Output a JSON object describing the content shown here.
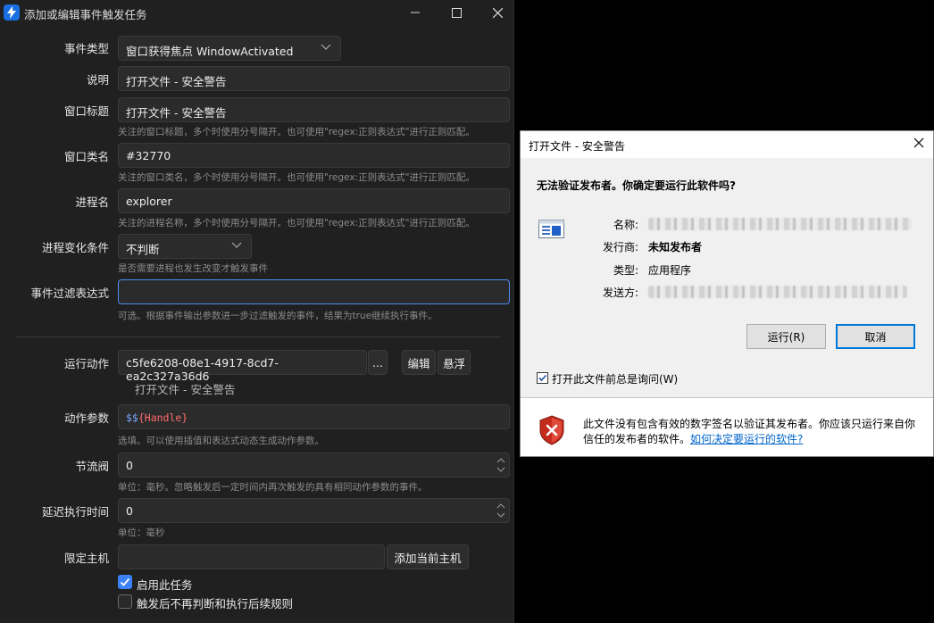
{
  "window": {
    "title": "添加或编辑事件触发任务",
    "controls": {
      "minimize": "—",
      "maximize": "☐",
      "close": "✕"
    }
  },
  "form": {
    "event_type": {
      "label": "事件类型",
      "value": "窗口获得焦点 WindowActivated"
    },
    "description": {
      "label": "说明",
      "value": "打开文件 - 安全警告"
    },
    "window_title": {
      "label": "窗口标题",
      "value": "打开文件 - 安全警告",
      "hint": "关注的窗口标题，多个时使用分号隔开。也可使用\"regex:正则表达式\"进行正则匹配。"
    },
    "window_class": {
      "label": "窗口类名",
      "value": "#32770",
      "hint": "关注的窗口类名，多个时使用分号隔开。也可使用\"regex:正则表达式\"进行正则匹配。"
    },
    "process_name": {
      "label": "进程名",
      "value": "explorer",
      "hint": "关注的进程名称，多个时使用分号隔开。也可使用\"regex:正则表达式\"进行正则匹配。"
    },
    "process_change": {
      "label": "进程变化条件",
      "value": "不判断",
      "hint": "是否需要进程也发生改变才触发事件"
    },
    "filter_expr": {
      "label": "事件过滤表达式",
      "value": "",
      "hint": "可选。根据事件输出参数进一步过滤触发的事件，结果为true继续执行事件。"
    },
    "run_action": {
      "label": "运行动作",
      "value": "c5fe6208-08e1-4917-8cd7-ea2c327a36d6",
      "browse": "...",
      "edit": "编辑",
      "float": "悬浮",
      "sub": "打开文件 - 安全警告"
    },
    "action_params": {
      "label": "动作参数",
      "prefix": "$$",
      "value": "{Handle}",
      "hint": "选填。可以使用插值和表达式动态生成动作参数。"
    },
    "throttle": {
      "label": "节流阀",
      "value": "0",
      "hint": "单位：毫秒。忽略触发后一定时间内再次触发的具有相同动作参数的事件。"
    },
    "delay": {
      "label": "延迟执行时间",
      "value": "0",
      "hint": "单位：毫秒"
    },
    "host": {
      "label": "限定主机",
      "value": "",
      "add_button": "添加当前主机"
    },
    "enable_task": {
      "label": "启用此任务",
      "checked": true
    },
    "stop_after": {
      "label": "触发后不再判断和执行后续规则",
      "checked": false
    }
  },
  "security_dialog": {
    "title": "打开文件 - 安全警告",
    "close": "✕",
    "heading": "无法验证发布者。你确定要运行此软件吗?",
    "name_label": "名称:",
    "publisher_label": "发行商:",
    "publisher_value": "未知发布者",
    "type_label": "类型:",
    "type_value": "应用程序",
    "from_label": "发送方:",
    "run_button": "运行(R)",
    "cancel_button": "取消",
    "always_ask": "打开此文件前总是询问(W)",
    "always_ask_checked": true,
    "footer_text": "此文件没有包含有效的数字签名以验证其发布者。你应该只运行来自你信任的发布者的软件。",
    "footer_link": "如何决定要运行的软件?"
  },
  "colors": {
    "accent": "#3b82f6",
    "dark_bg": "#202020",
    "field_bg": "#2b2b2b",
    "link": "#0066cc",
    "param_prefix": "#7aa7ff",
    "param_value": "#ff6b6b"
  }
}
